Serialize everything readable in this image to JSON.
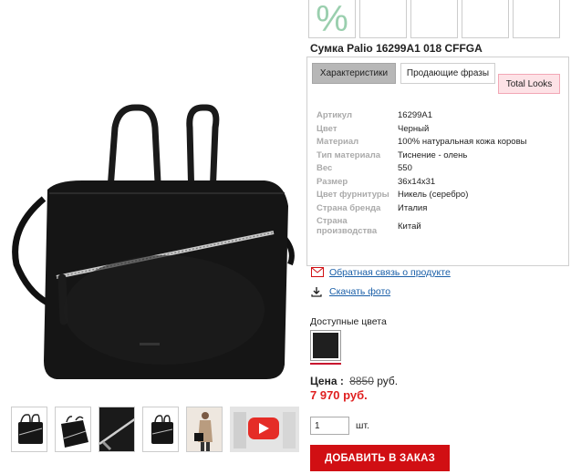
{
  "product": {
    "title": "Сумка Palio 16299A1 018 CFFGA"
  },
  "tiles": {
    "badge": "%"
  },
  "tabs": {
    "specs": "Характеристики",
    "phrases": "Продающие фразы",
    "looks": "Total Looks"
  },
  "specs": [
    {
      "key": "Артикул",
      "value": "16299A1"
    },
    {
      "key": "Цвет",
      "value": "Черный"
    },
    {
      "key": "Материал",
      "value": "100% натуральная кожа коровы"
    },
    {
      "key": "Тип материала",
      "value": "Тиснение - олень"
    },
    {
      "key": "Вес",
      "value": "550"
    },
    {
      "key": "Размер",
      "value": "36x14x31"
    },
    {
      "key": "Цвет фурнитуры",
      "value": "Никель (серебро)"
    },
    {
      "key": "Страна бренда",
      "value": "Италия"
    },
    {
      "key": "Страна производства",
      "value": "Китай"
    }
  ],
  "links": {
    "feedback": "Обратная связь о продукте",
    "download": "Скачать фото"
  },
  "colors": {
    "label": "Доступные цвета",
    "swatch": "#1f1f1f"
  },
  "price": {
    "label": "Цена :",
    "old": "8850",
    "currency": "руб.",
    "new": "7 970 руб."
  },
  "quantity": {
    "value": "1",
    "unit": "шт."
  },
  "order": {
    "button": "ДОБАВИТЬ В ЗАКАЗ"
  },
  "style": {
    "accent": "#d10f13",
    "price_color": "#e02020",
    "link_color": "#1a5fa8"
  }
}
